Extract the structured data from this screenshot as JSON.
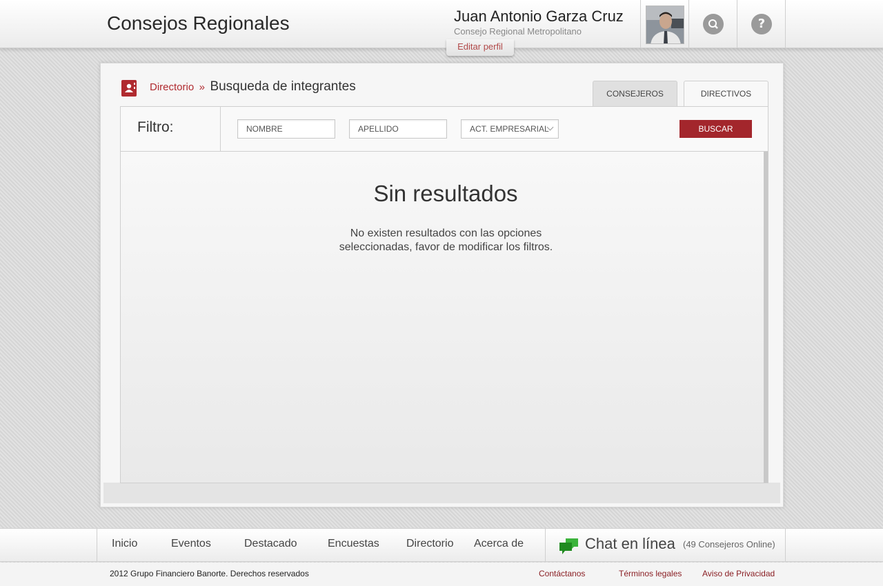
{
  "header": {
    "app_title": "Consejos Regionales",
    "user_name": "Juan Antonio Garza Cruz",
    "user_council": "Consejo Regional Metropolitano",
    "edit_profile": "Editar perfil",
    "search_icon": "search-icon",
    "help_icon": "help-icon",
    "help_glyph": "?"
  },
  "breadcrumb": {
    "link": "Directorio",
    "separator": "»",
    "current": "Busqueda de integrantes"
  },
  "tabs": [
    {
      "label": "CONSEJEROS",
      "active": true
    },
    {
      "label": "DIRECTIVOS",
      "active": false
    }
  ],
  "filter": {
    "label": "Filtro:",
    "nombre_placeholder": "NOMBRE",
    "apellido_placeholder": "APELLIDO",
    "actividad_value": "ACT. EMPRESARIAL",
    "search_button": "BUSCAR"
  },
  "results": {
    "title": "Sin resultados",
    "message": "No existen resultados con las opciones seleccionadas, favor de modificar los filtros."
  },
  "footer_nav": {
    "items": [
      "Inicio",
      "Eventos",
      "Destacado",
      "Encuestas",
      "Directorio",
      "Acerca de"
    ],
    "chat_label": "Chat en línea",
    "chat_count": "(49 Consejeros Online)"
  },
  "footer": {
    "copyright": "2012 Grupo Financiero Banorte. Derechos reservados",
    "links": [
      "Contáctanos",
      "Términos legales",
      "Aviso de Privacidad"
    ]
  },
  "colors": {
    "accent": "#a3262c",
    "chat_green": "#2e9a2e"
  }
}
